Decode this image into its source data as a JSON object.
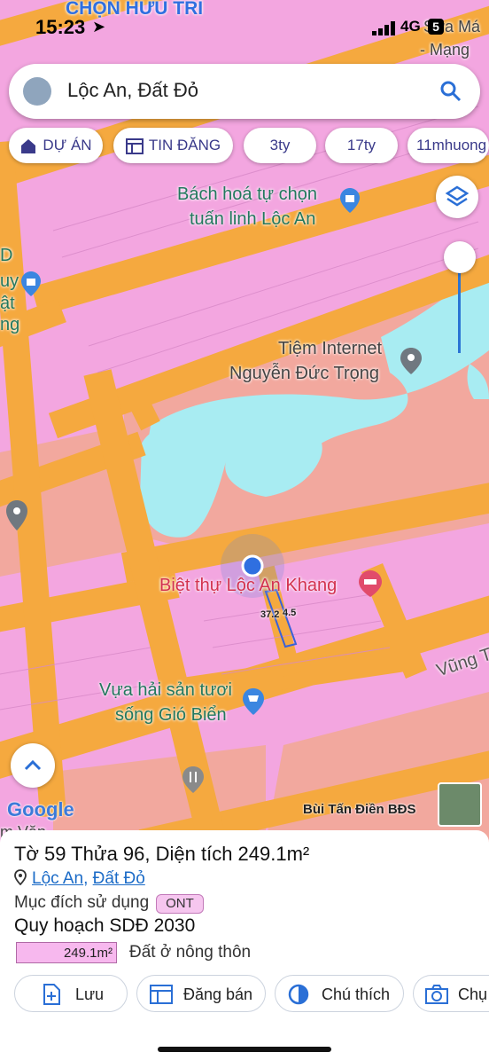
{
  "status_bar": {
    "time": "15:23",
    "network": "4G",
    "battery": "5"
  },
  "search": {
    "query": "Lộc An, Đất Đỏ"
  },
  "chips": [
    {
      "label": "DỰ ÁN",
      "icon": "house-icon"
    },
    {
      "label": "TIN ĐĂNG",
      "icon": "listing-icon"
    },
    {
      "label": "3ty"
    },
    {
      "label": "17ty"
    },
    {
      "label": "11mhuong"
    }
  ],
  "map_labels": {
    "top": "CHỌN HƯU TRÍ",
    "top_right_1": "Sửa Má",
    "top_right_2": "- Mạng",
    "poi_bachhoa_1": "Bách hoá tự chọn",
    "poi_bachhoa_2": "tuấn linh Lộc An",
    "left_d": "D",
    "left_uy": "uy",
    "left_at": "ật",
    "left_ng": "ng",
    "poi_internet_1": "Tiệm Internet",
    "poi_internet_2": "Nguyễn Đức Trọng",
    "poi_bietthu": "Biệt thự Lộc An Khang",
    "dim_1": "37.2",
    "dim_2": "4.5",
    "road": "Vũng T",
    "poi_vua_1": "Vựa hải sản tươi",
    "poi_vua_2": "sống Gió Biển",
    "bottom_left": "m Văn"
  },
  "google_logo": "Google",
  "credit": "Bùi Tấn Điền BĐS",
  "parcel": {
    "title": "Tờ 59 Thửa 96, Diện tích 249.1m²",
    "commune": "Lộc An",
    "separator": ", ",
    "district": "Đất Đỏ",
    "purpose_label": "Mục đích sử dụng",
    "purpose_code": "ONT",
    "plan_title": "Quy hoạch SDĐ 2030",
    "plan_area": "249.1m²",
    "plan_landtype": "Đất ở nông thôn"
  },
  "actions": [
    {
      "label": "Lưu",
      "icon": "save-icon"
    },
    {
      "label": "Đăng bán",
      "icon": "listing-icon"
    },
    {
      "label": "Chú thích",
      "icon": "legend-icon"
    },
    {
      "label": "Chụ",
      "icon": "camera-icon"
    }
  ],
  "colors": {
    "road": "#f5a93f",
    "residential": "#f3a6e0",
    "water": "#a8ecf2",
    "other_land": "#f2a89e",
    "accent": "#1b6bc7"
  }
}
